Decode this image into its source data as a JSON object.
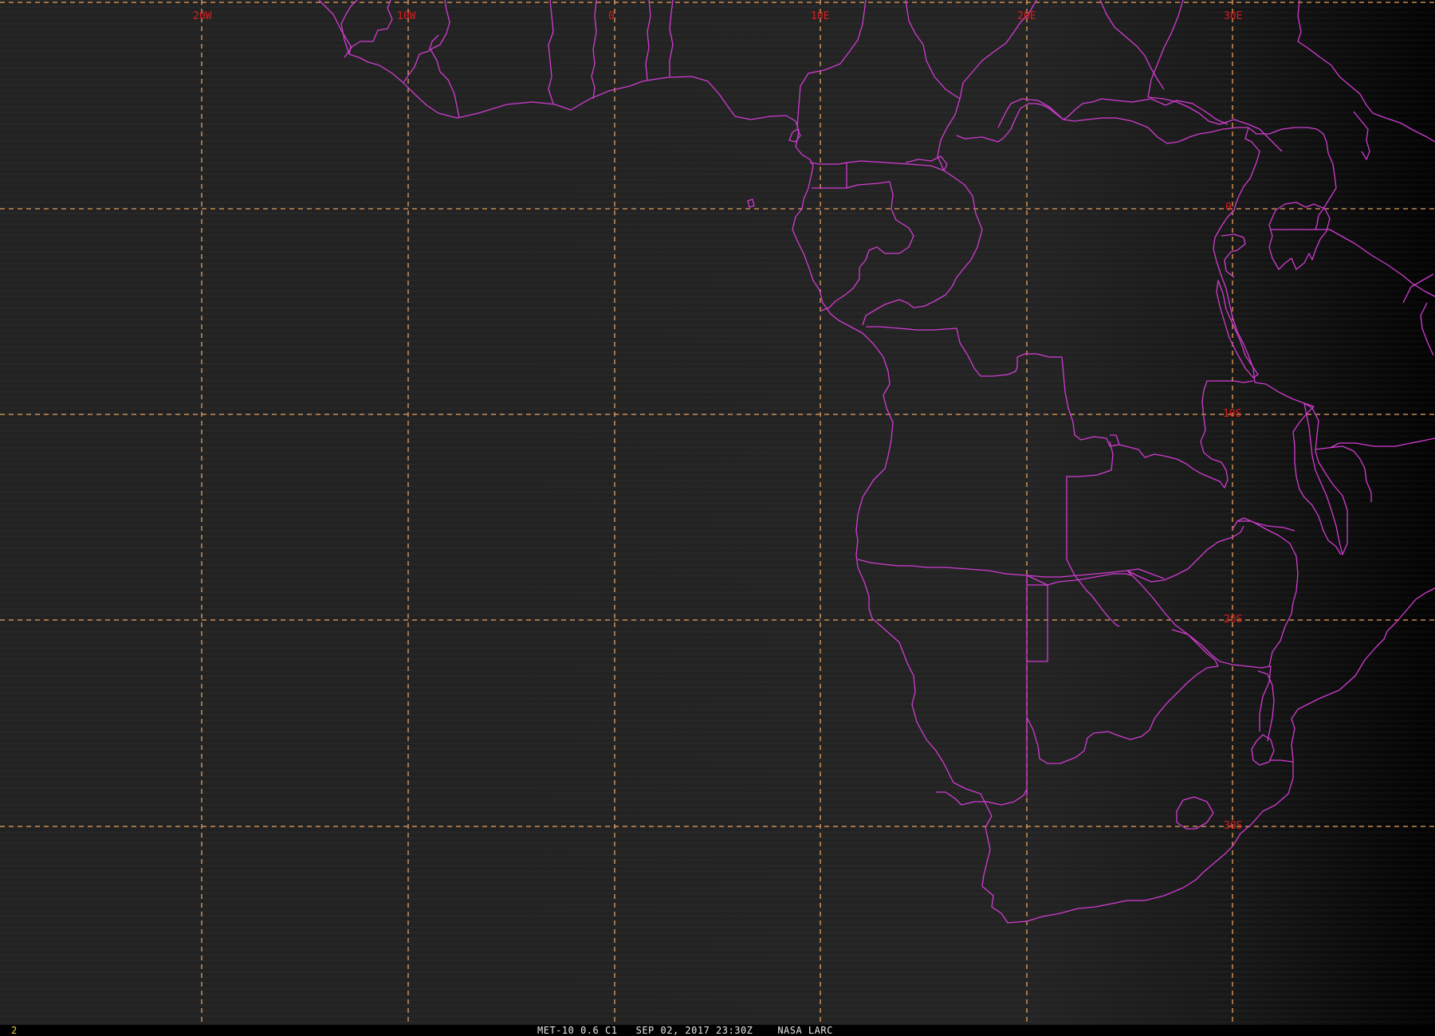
{
  "map": {
    "product": "MET-10 0.6 C1",
    "date": "SEP 02, 2017",
    "time": "23:30Z",
    "source": "NASA LARC",
    "frame_number": "2",
    "background": "#1e1e1e",
    "colors": {
      "borders": "#d23cd2",
      "grid": "#e8a060",
      "grid_labels": "#d81e1e",
      "frame_number": "#e8d040",
      "caption": "#e6e6e6"
    },
    "longitude_labels": [
      "20W",
      "10W",
      "0",
      "10E",
      "20E",
      "30E"
    ],
    "latitude_labels": [
      "0",
      "10S",
      "20S",
      "30S"
    ]
  }
}
